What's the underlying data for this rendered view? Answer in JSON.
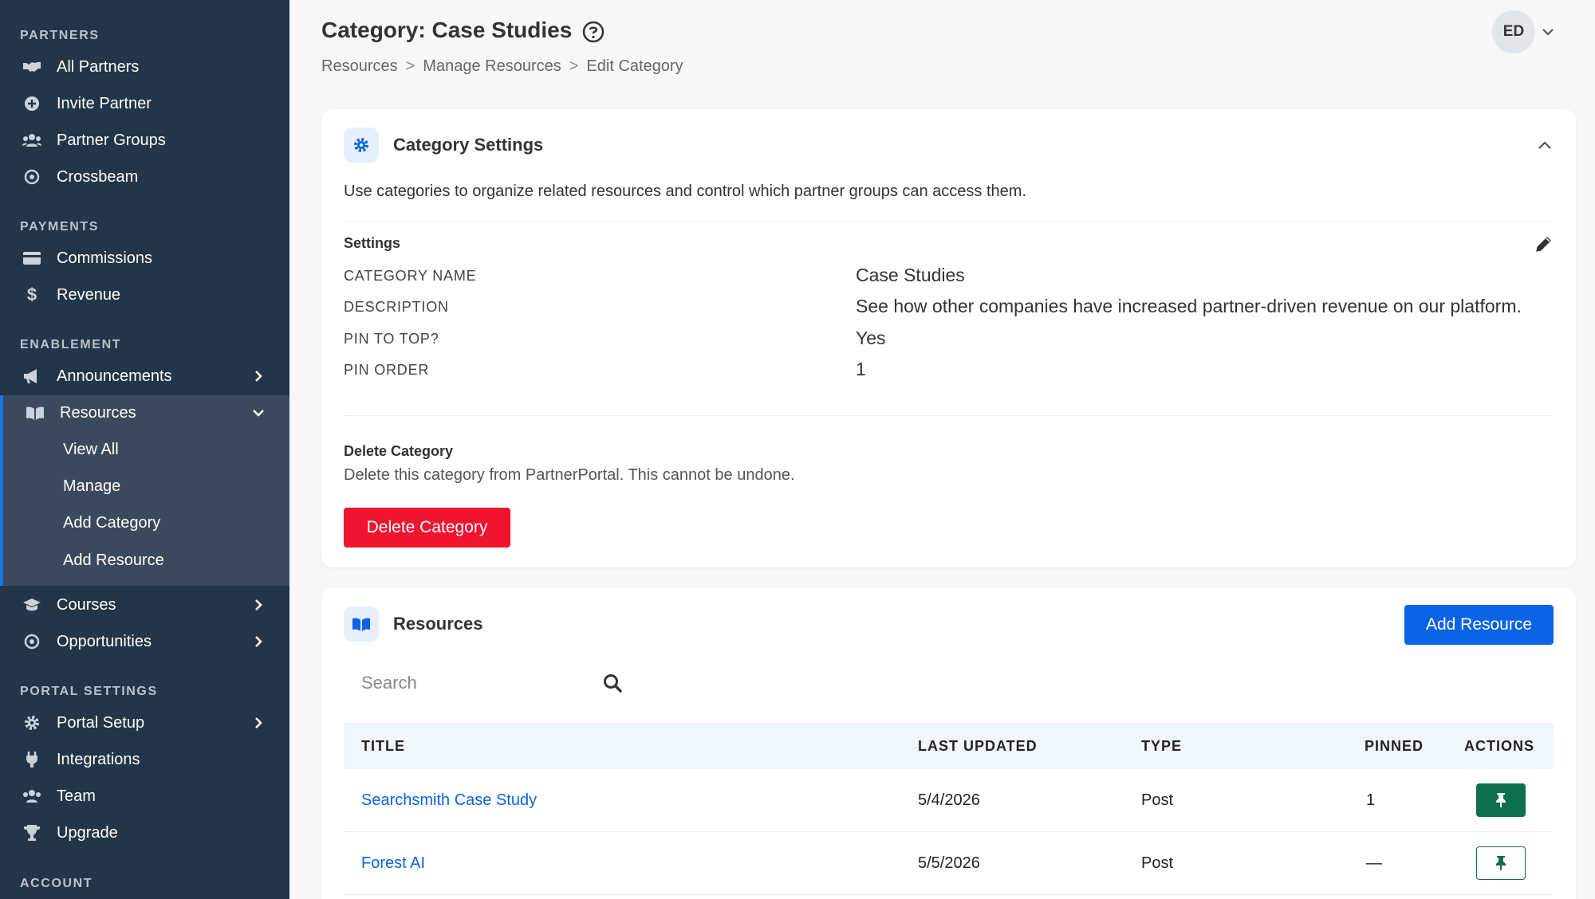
{
  "sidebar": {
    "sections": {
      "partners": "PARTNERS",
      "payments": "PAYMENTS",
      "enablement": "ENABLEMENT",
      "portal_settings": "PORTAL SETTINGS",
      "account": "ACCOUNT"
    },
    "items": {
      "all_partners": "All Partners",
      "invite_partner": "Invite Partner",
      "partner_groups": "Partner Groups",
      "crossbeam": "Crossbeam",
      "commissions": "Commissions",
      "revenue": "Revenue",
      "announcements": "Announcements",
      "resources": "Resources",
      "courses": "Courses",
      "opportunities": "Opportunities",
      "portal_setup": "Portal Setup",
      "integrations": "Integrations",
      "team": "Team",
      "upgrade": "Upgrade"
    },
    "resources_sub": {
      "view_all": "View All",
      "manage": "Manage",
      "add_category": "Add Category",
      "add_resource": "Add Resource"
    },
    "accent_color": "#1a73e8"
  },
  "header": {
    "title": "Category: Case Studies",
    "breadcrumb": [
      "Resources",
      "Manage Resources",
      "Edit Category"
    ],
    "breadcrumb_sep": ">",
    "avatar_initials": "ED"
  },
  "settings_card": {
    "title": "Category Settings",
    "description": "Use categories to organize related resources and control which partner groups can access them.",
    "settings_heading": "Settings",
    "fields": {
      "name_label": "CATEGORY NAME",
      "name_value": "Case Studies",
      "desc_label": "DESCRIPTION",
      "desc_value": "See how other companies have increased partner-driven revenue on our platform.",
      "pin_label": "PIN TO TOP?",
      "pin_value": "Yes",
      "order_label": "PIN ORDER",
      "order_value": "1"
    },
    "delete_heading": "Delete Category",
    "delete_desc": "Delete this category from PartnerPortal. This cannot be undone.",
    "delete_button": "Delete Category",
    "danger_color": "#f0142f"
  },
  "resources_card": {
    "title": "Resources",
    "add_button": "Add Resource",
    "search_placeholder": "Search",
    "columns": {
      "title": "TITLE",
      "last_updated": "LAST UPDATED",
      "type": "TYPE",
      "pinned": "PINNED",
      "actions": "ACTIONS"
    },
    "rows": [
      {
        "title": "Searchsmith Case Study",
        "last_updated": "5/4/2026",
        "type": "Post",
        "pinned": "1"
      },
      {
        "title": "Forest AI",
        "last_updated": "5/5/2026",
        "type": "Post",
        "pinned": "—"
      }
    ],
    "primary_color": "#0b63e5",
    "pin_color": "#0f6e4f"
  }
}
